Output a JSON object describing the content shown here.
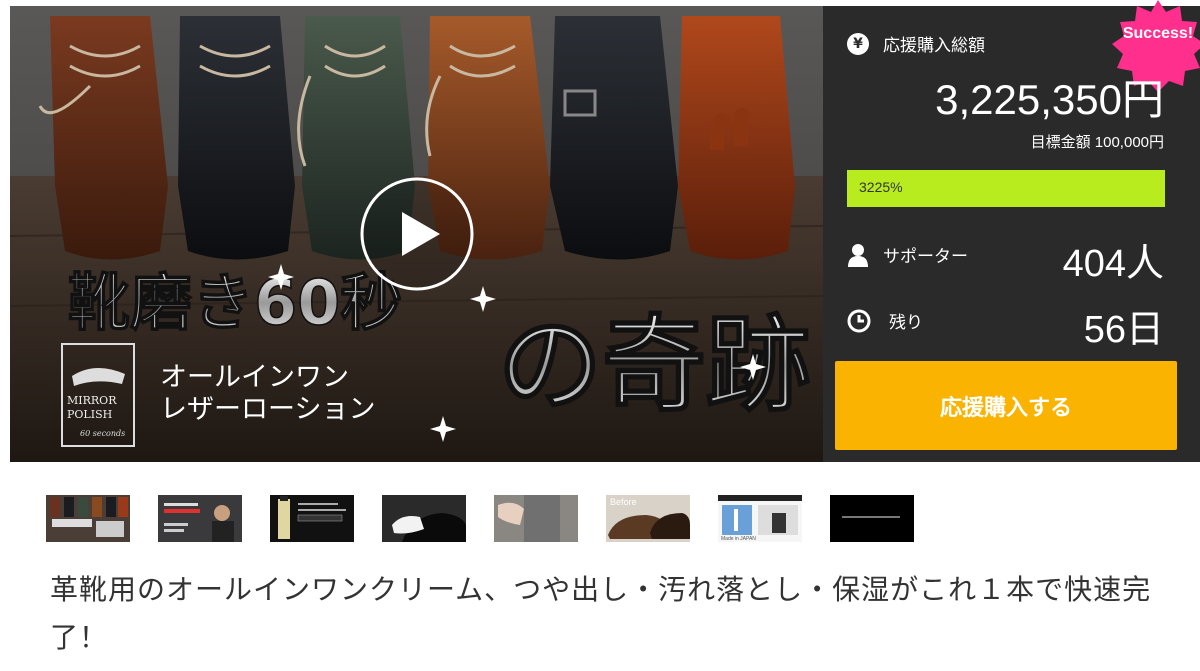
{
  "hero": {
    "title_line1": "靴磨き60秒",
    "title_line2": "の奇跡",
    "subtitle_line1": "オールインワン",
    "subtitle_line2": "レザーローション",
    "logo_line1": "MIRROR",
    "logo_line2": "POLISH",
    "logo_line3": "60 seconds"
  },
  "stats": {
    "total_label": "応援購入総額",
    "total_amount": "3,225,350円",
    "goal_text": "目標金額 100,000円",
    "progress_text": "3225%",
    "progress_fraction": 1.0,
    "supporters_label": "サポーター",
    "supporters_value": "404人",
    "remaining_label": "残り",
    "remaining_value": "56日",
    "badge_text": "Success!",
    "cta_label": "応援購入する",
    "yen_symbol": "¥"
  },
  "colors": {
    "panel_bg": "#2a2a2a",
    "progress_fill": "#b8ec1e",
    "cta": "#f9b300",
    "badge": "#ff2f8e"
  },
  "thumbnails": [
    {
      "name": "thumb-hero"
    },
    {
      "name": "thumb-man-red-text"
    },
    {
      "name": "thumb-bottle"
    },
    {
      "name": "thumb-cloth-shoe"
    },
    {
      "name": "thumb-hand"
    },
    {
      "name": "thumb-before"
    },
    {
      "name": "thumb-factory"
    },
    {
      "name": "thumb-black"
    }
  ],
  "thumb_text": {
    "before": "Before",
    "made_in_japan": "Made in JAPAN"
  },
  "description": "革靴用のオールインワンクリーム、つや出し・汚れ落とし・保湿がこれ１本で快速完了！"
}
